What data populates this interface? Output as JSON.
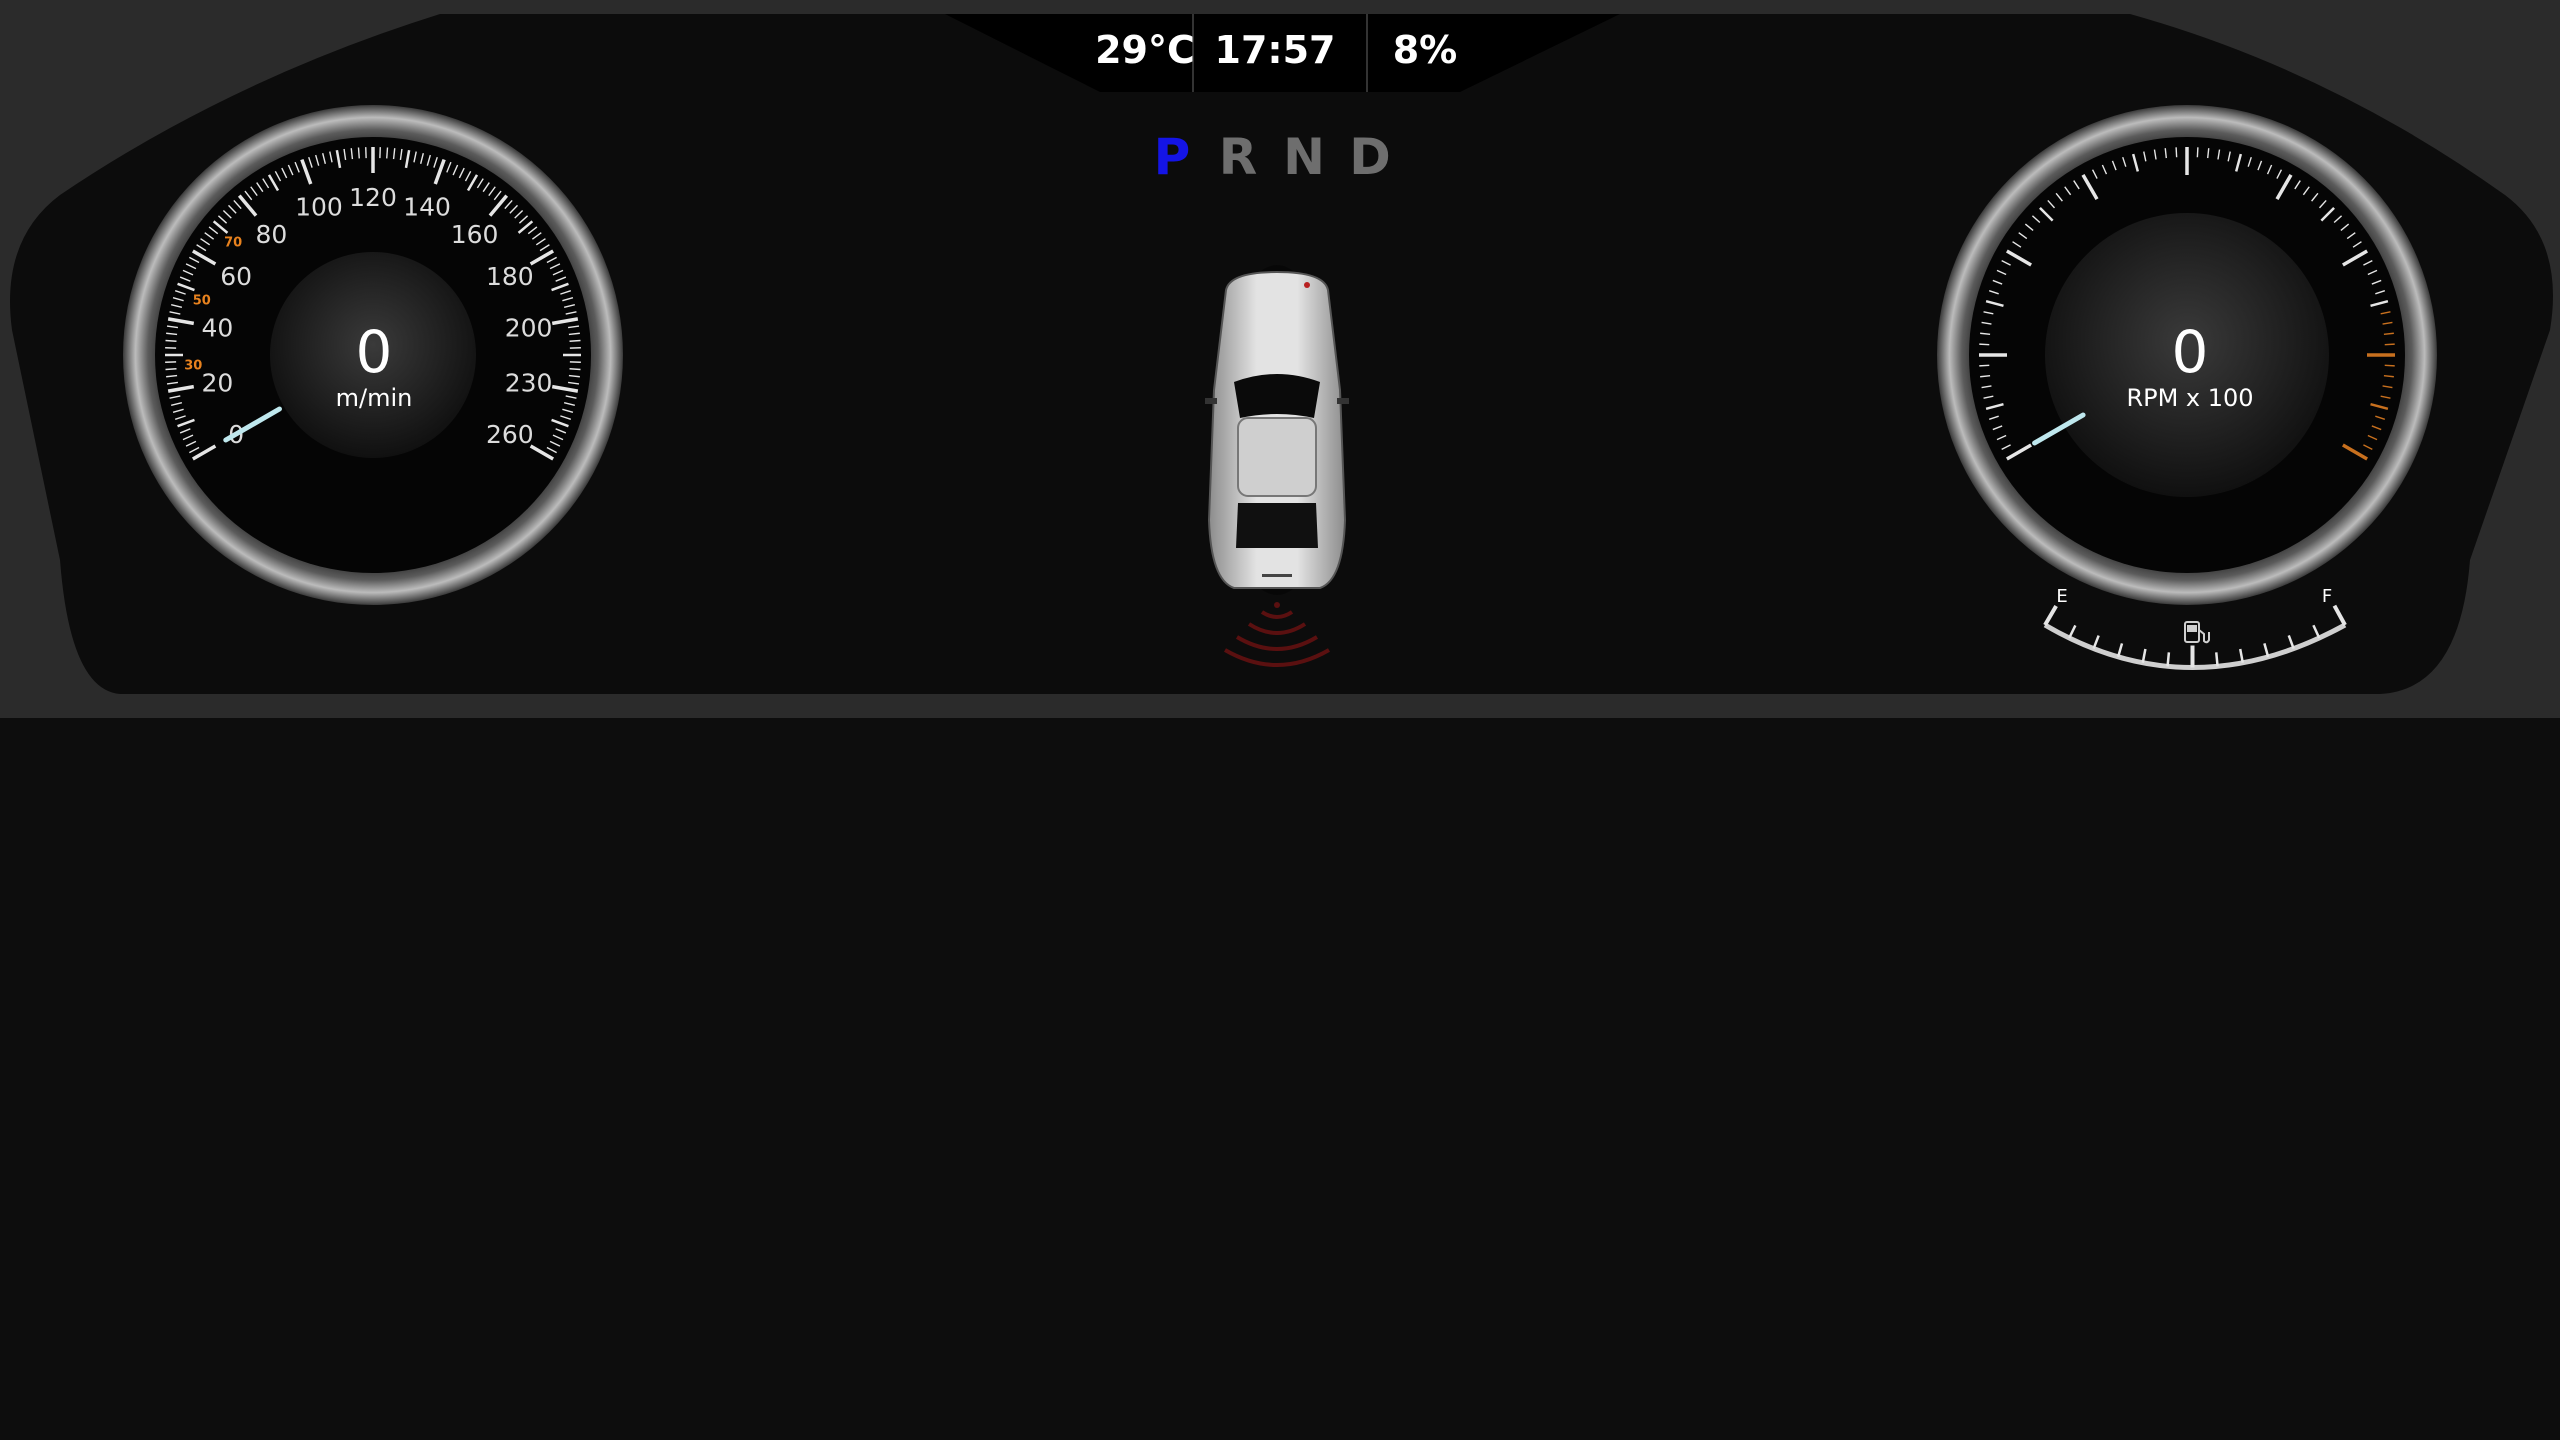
{
  "status_bar": {
    "temperature": "29°C",
    "time": "17:57",
    "battery": "8%"
  },
  "gear_selector": {
    "gears": [
      "P",
      "R",
      "N",
      "D"
    ],
    "active": "P"
  },
  "speedometer": {
    "value": "0",
    "unit": "m/min",
    "main_labels": [
      "0",
      "20",
      "40",
      "60",
      "80",
      "100",
      "120",
      "140",
      "160",
      "180",
      "200",
      "230",
      "260"
    ],
    "inner_labels": [
      "30",
      "50",
      "70"
    ],
    "needle_value": 0
  },
  "tachometer": {
    "value": "0",
    "unit": "RPM x 100",
    "needle_value": 0
  },
  "fuel_gauge": {
    "empty_label": "E",
    "full_label": "F",
    "icon": "fuel-pump-icon"
  },
  "parking_sensor": {
    "icon": "rear-proximity-waves-icon"
  },
  "vehicle": {
    "icon": "car-top-view-icon"
  },
  "colors": {
    "active_gear": "#1414e6",
    "inactive_gear": "#6e6e6e",
    "needle": "#bfe8ee",
    "inner_scale": "#e8821e",
    "redline": "#c8701e",
    "sensor_wave": "#5a1010"
  }
}
